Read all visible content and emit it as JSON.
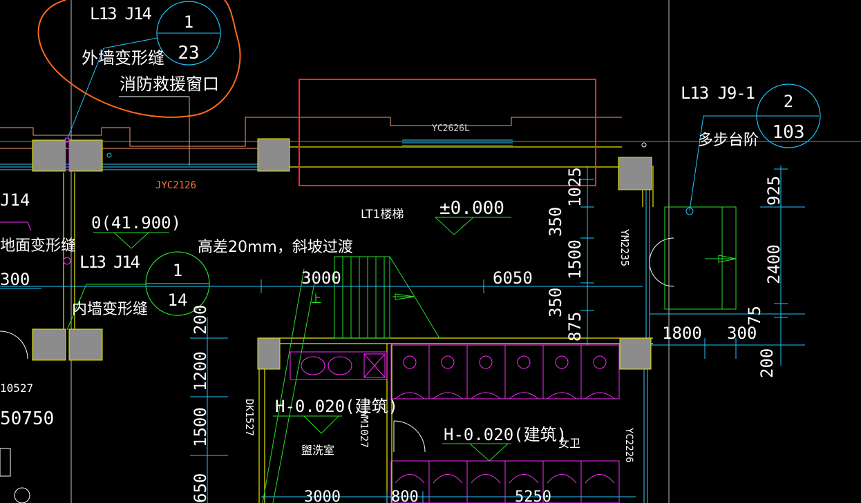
{
  "drawing": {
    "callouts": {
      "top_left": {
        "ref": "L13 J14",
        "num": "1",
        "page": "23",
        "label1": "外墙变形缝",
        "label2": "消防救援窗口"
      },
      "top_right": {
        "ref": "L13 J9-1",
        "num": "2",
        "page": "103",
        "label": "多步台阶"
      },
      "mid_left": {
        "ref": "L13 J14",
        "num": "1",
        "page": "14",
        "label": "内墙变形缝"
      }
    },
    "left_edge": {
      "ref_partial": "J14",
      "label_partial": "地面变形缝",
      "dim_partial": "300",
      "code_partial": "10527",
      "dim2_partial": "50750"
    },
    "window_codes": {
      "yc2626l": "YC2626L",
      "jyc2126": "JYC2126",
      "ym2235": "YM2235",
      "yc2226": "YC2226",
      "dk1527": "DK1527",
      "wm1027": "WM1027"
    },
    "elevations": {
      "e1": "0(41.900)",
      "e2": "±0.000",
      "e3": "H-0.020(建筑)",
      "e4": "H-0.020(建筑)"
    },
    "notes": {
      "slope": "高差20mm，斜坡过渡",
      "stair": "LT1楼梯",
      "washroom": "盥洗室",
      "female": "女卫",
      "up": "上"
    },
    "dimensions": {
      "d3000a": "3000",
      "d6050": "6050",
      "d1800": "1800",
      "d300": "300",
      "d3000b": "3000",
      "d800": "800",
      "d5250": "5250",
      "v1025": "1025",
      "v350a": "350",
      "v1500a": "1500",
      "v350b": "350",
      "v875": "875",
      "v925": "925",
      "v2400": "2400",
      "v75": "75",
      "v200r": "200",
      "v200l": "200",
      "v1200": "1200",
      "v1500b": "1500",
      "v650": "650"
    },
    "colors": {
      "background": "#000000",
      "highlight_box": "#ff2a2a",
      "annotation_circle": "#ff6a1a",
      "dimension": "#1ec8ff",
      "wall": "#e8e800",
      "fixtures": "#ff2aff",
      "leader": "#28e028",
      "window_text": "#ff7a3a"
    }
  }
}
